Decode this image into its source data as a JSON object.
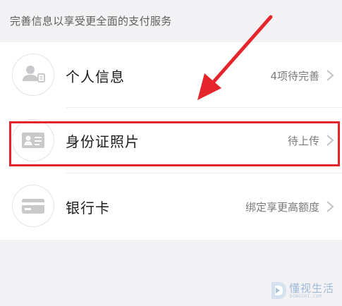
{
  "header": {
    "text": "完善信息以享受更全面的支付服务"
  },
  "rows": [
    {
      "label": "个人信息",
      "status": "4项待完善",
      "icon": "person-card-icon"
    },
    {
      "label": "身份证照片",
      "status": "待上传",
      "icon": "id-card-icon"
    },
    {
      "label": "银行卡",
      "status": "绑定享更高额度",
      "icon": "bank-card-icon"
    }
  ],
  "watermark": {
    "main": "懂视生活",
    "sub": "DONGSHI.COM"
  },
  "colors": {
    "highlight": "#e4252b",
    "icon_gray": "#c9c9cc"
  }
}
